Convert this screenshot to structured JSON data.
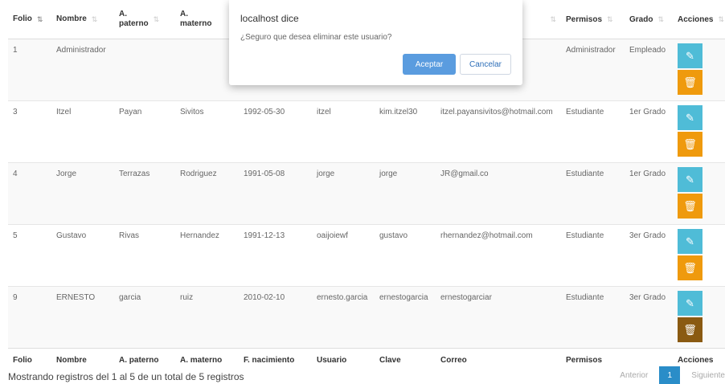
{
  "table": {
    "headers": [
      {
        "line1": "Folio",
        "line2": ""
      },
      {
        "line1": "Nombre",
        "line2": ""
      },
      {
        "line1": "A.",
        "line2": "paterno"
      },
      {
        "line1": "A.",
        "line2": "materno"
      },
      {
        "line1": "",
        "line2": ""
      },
      {
        "line1": "",
        "line2": ""
      },
      {
        "line1": "",
        "line2": ""
      },
      {
        "line1": "",
        "line2": ""
      },
      {
        "line1": "Permisos",
        "line2": ""
      },
      {
        "line1": "Grado",
        "line2": ""
      },
      {
        "line1": "Acciones",
        "line2": ""
      }
    ],
    "footer": [
      "Folio",
      "Nombre",
      "A. paterno",
      "A. materno",
      "F. nacimiento",
      "Usuario",
      "Clave",
      "Correo",
      "Permisos",
      "Acciones"
    ],
    "rows": [
      {
        "folio": "1",
        "nombre": "Administrador",
        "paterno": "",
        "materno": "",
        "nacimiento": "",
        "usuario": "",
        "clave": "",
        "correo": "",
        "permisos": "Administrador",
        "grado": "Empleado"
      },
      {
        "folio": "3",
        "nombre": "Itzel",
        "paterno": "Payan",
        "materno": "Sivitos",
        "nacimiento": "1992-05-30",
        "usuario": "itzel",
        "clave": "kim.itzel30",
        "correo": "itzel.payansivitos@hotmail.com",
        "permisos": "Estudiante",
        "grado": "1er Grado"
      },
      {
        "folio": "4",
        "nombre": "Jorge",
        "paterno": "Terrazas",
        "materno": "Rodriguez",
        "nacimiento": "1991-05-08",
        "usuario": "jorge",
        "clave": "jorge",
        "correo": "JR@gmail.co",
        "permisos": "Estudiante",
        "grado": "1er Grado"
      },
      {
        "folio": "5",
        "nombre": "Gustavo",
        "paterno": "Rivas",
        "materno": "Hernandez",
        "nacimiento": "1991-12-13",
        "usuario": "oaijoiewf",
        "clave": "gustavo",
        "correo": "rhernandez@hotmail.com",
        "permisos": "Estudiante",
        "grado": "3er Grado"
      },
      {
        "folio": "9",
        "nombre": "ERNESTO",
        "paterno": "garcia",
        "materno": "ruiz",
        "nacimiento": "2010-02-10",
        "usuario": "ernesto.garcia",
        "clave": "ernestogarcia",
        "correo": "ernestogarciar",
        "permisos": "Estudiante",
        "grado": "3er Grado"
      }
    ]
  },
  "icons": {
    "sort": "sort-arrows-icon",
    "edit": "pencil-icon",
    "delete": "trash-icon"
  },
  "info": "Mostrando registros del 1 al 5 de un total de 5 registros",
  "pagination": {
    "prev": "Anterior",
    "current": "1",
    "next": "Siguiente"
  },
  "dialog": {
    "title": "localhost dice",
    "message": "¿Seguro que desea eliminar este usuario?",
    "ok": "Aceptar",
    "cancel": "Cancelar"
  },
  "colors": {
    "edit": "#4fbcd7",
    "delete": "#ef9a0d",
    "delete_active": "#8a5a12",
    "accept": "#5a9cdf",
    "page_active": "#2a8dc8"
  }
}
